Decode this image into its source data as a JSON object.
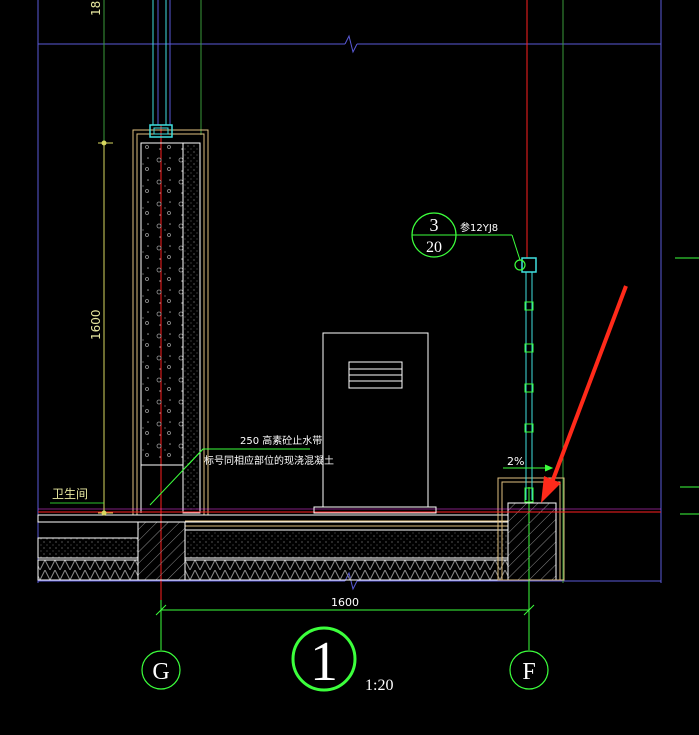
{
  "labels": {
    "top_cut_dim": "18",
    "vertical_dim": "1600",
    "room_label": "卫生间",
    "waterproof_band": "250 高素砼止水带",
    "waterproof_note": "标号同相应部位的现浇混凝土",
    "slope": "2%",
    "detail_ref_ref": "3",
    "detail_ref_sheet": "20",
    "detail_ref_std": "参12YJ8",
    "bottom_dim": "1600",
    "axis_left": "G",
    "axis_right": "F",
    "detail_number": "1",
    "scale": "1:20"
  },
  "colors": {
    "background": "#000000",
    "frame_blue": "#5a5ad8",
    "green": "#3cff3c",
    "dim_green": "#21c021",
    "red": "#ff2020",
    "magenta": "#ff40ff",
    "cyan": "#40e0e0",
    "white": "#ffffff",
    "yellow_dim": "#d8d860",
    "tan": "#e0c080",
    "arrow": "#ff2a1a"
  }
}
